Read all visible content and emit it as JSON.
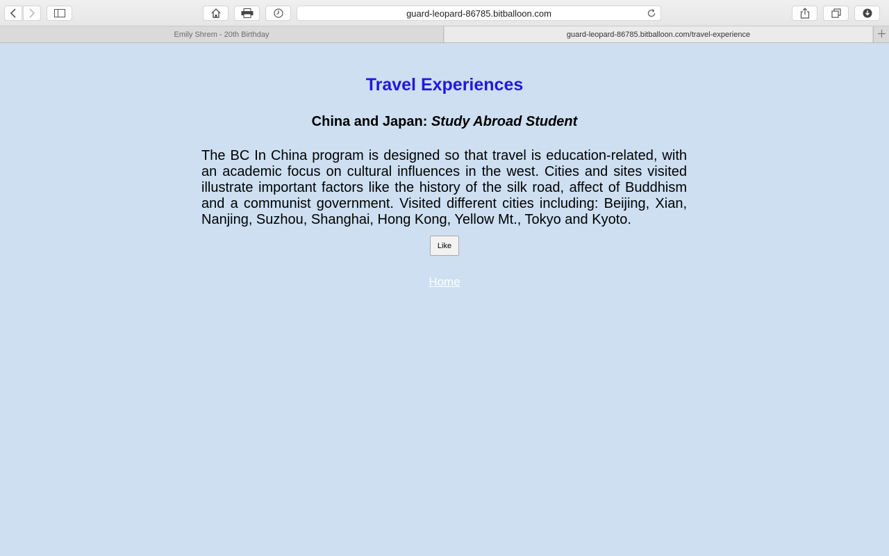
{
  "browser": {
    "url": "guard-leopard-86785.bitballoon.com",
    "tabs": [
      {
        "title": "Emily Shrem - 20th Birthday",
        "active": false
      },
      {
        "title": "guard-leopard-86785.bitballoon.com/travel-experience",
        "active": true
      }
    ],
    "icons": [
      "back-icon",
      "forward-icon",
      "sidebar-icon",
      "home-icon",
      "print-icon",
      "history-icon",
      "reload-icon",
      "share-icon",
      "tabs-overview-icon",
      "download-icon",
      "new-tab-icon"
    ]
  },
  "page": {
    "title": "Travel Experiences",
    "section": {
      "heading_prefix": "China and Japan:",
      "heading_emphasis": "Study Abroad Student",
      "description": "The BC In China program is designed so that travel is education-related, with an academic focus on cultural influences in the west. Cities and sites visited illustrate important factors like the history of the silk road, affect of Buddhism and a communist government. Visited different cities including: Beijing, Xian, Nanjing, Suzhou, Shanghai, Hong Kong, Yellow Mt., Tokyo and Kyoto.",
      "like_label": "Like"
    },
    "home_link": "Home"
  },
  "colors": {
    "background": "#cddff1",
    "title": "#2416e0",
    "link": "#ffffff"
  }
}
